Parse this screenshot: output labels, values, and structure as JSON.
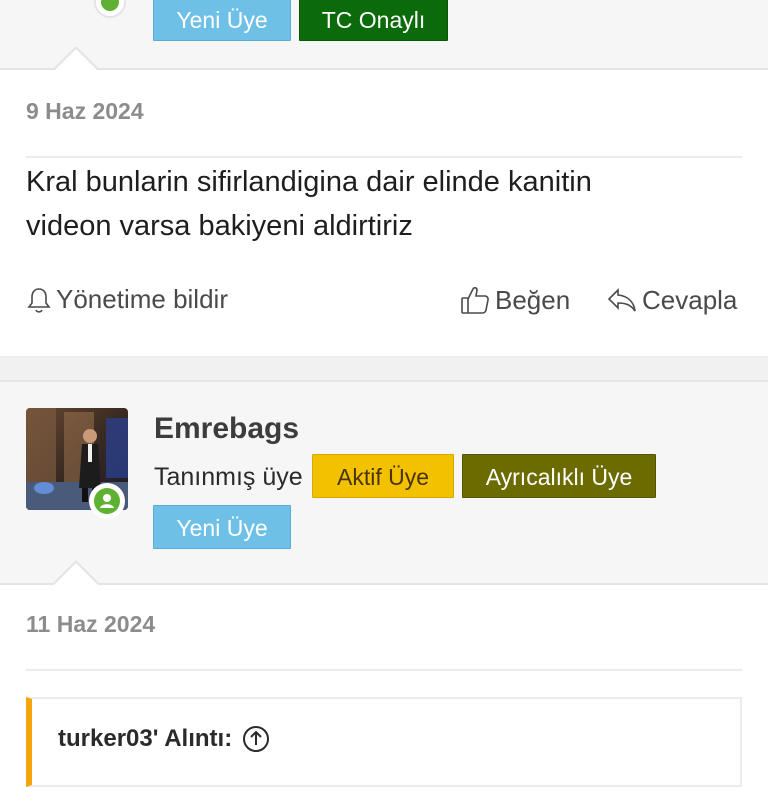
{
  "top_user": {
    "badges": [
      "Yeni Üye",
      "TC Onaylı"
    ]
  },
  "post1": {
    "date": "9 Haz 2024",
    "body_line1": "Kral bunlarin sifirlandigina dair elinde kanitin",
    "body_line2": "videon varsa bakiyeni aldirtiriz",
    "report_label": "Yönetime bildir",
    "like_label": "Beğen",
    "reply_label": "Cevapla"
  },
  "user2": {
    "username": "Emrebags",
    "title": "Tanınmış üye",
    "badges": [
      "Aktif Üye",
      "Ayrıcalıklı Üye",
      "Yeni Üye"
    ]
  },
  "post2": {
    "date": "11 Haz 2024",
    "quote_author": "turker03' Alıntı:"
  },
  "colors": {
    "badge_blue": "#6ec0e6",
    "badge_green": "#0b6b0b",
    "badge_yellow": "#f2c200",
    "badge_olive": "#6b6b00",
    "online": "#5fb132",
    "quote_accent": "#f2a60c"
  },
  "icons": {
    "report": "bell-icon",
    "like": "thumbs-up-icon",
    "reply": "reply-icon",
    "quote_jump": "arrow-up-circle-icon",
    "online": "online-status-icon"
  }
}
